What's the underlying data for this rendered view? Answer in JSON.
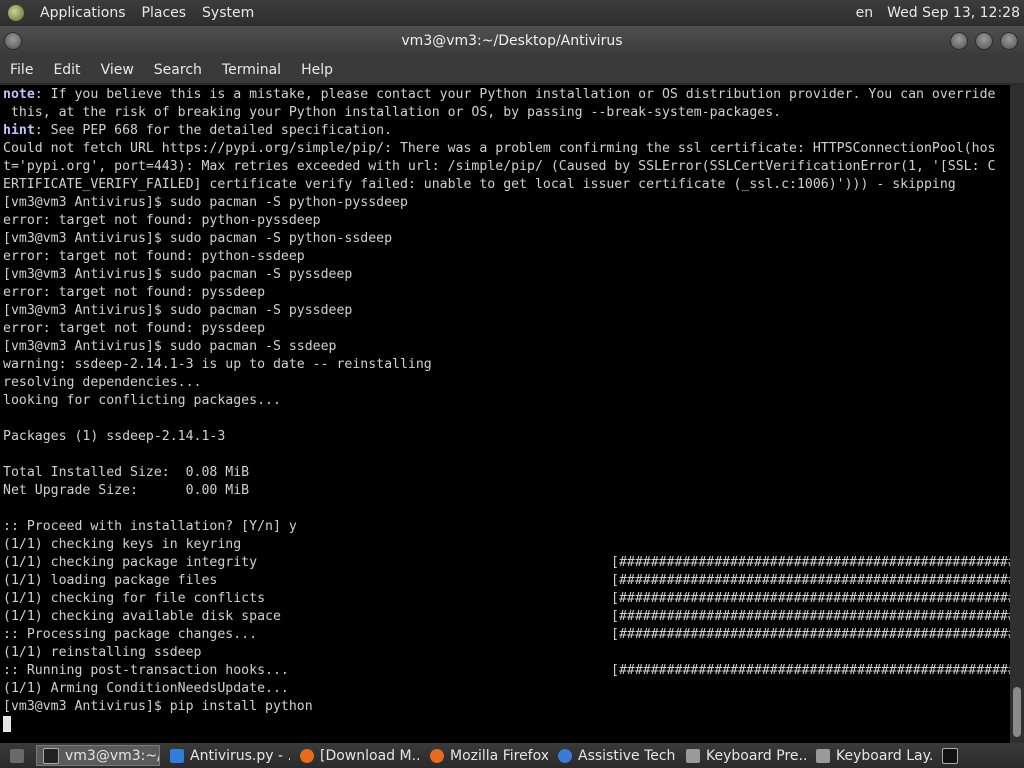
{
  "top_panel": {
    "menus": [
      "Applications",
      "Places",
      "System"
    ],
    "lang": "en",
    "clock": "Wed Sep 13, 12:28"
  },
  "window": {
    "title": "vm3@vm3:~/Desktop/Antivirus"
  },
  "menubar": [
    "File",
    "Edit",
    "View",
    "Search",
    "Terminal",
    "Help"
  ],
  "terminal": {
    "note_label": "note",
    "note_line1": ": If you believe this is a mistake, please contact your Python installation or OS distribution provider. You can override",
    "note_line2": " this, at the risk of breaking your Python installation or OS, by passing --break-system-packages.",
    "hint_label": "hint",
    "hint_text": ": See PEP 668 for the detailed specification.",
    "lines": [
      "Could not fetch URL https://pypi.org/simple/pip/: There was a problem confirming the ssl certificate: HTTPSConnectionPool(hos",
      "t='pypi.org', port=443): Max retries exceeded with url: /simple/pip/ (Caused by SSLError(SSLCertVerificationError(1, '[SSL: C",
      "ERTIFICATE_VERIFY_FAILED] certificate verify failed: unable to get local issuer certificate (_ssl.c:1006)'))) - skipping",
      "[vm3@vm3 Antivirus]$ sudo pacman -S python-pyssdeep",
      "error: target not found: python-pyssdeep",
      "[vm3@vm3 Antivirus]$ sudo pacman -S python-ssdeep",
      "error: target not found: python-ssdeep",
      "[vm3@vm3 Antivirus]$ sudo pacman -S pyssdeep",
      "error: target not found: pyssdeep",
      "[vm3@vm3 Antivirus]$ sudo pacman -S pyssdeep",
      "error: target not found: pyssdeep",
      "[vm3@vm3 Antivirus]$ sudo pacman -S ssdeep",
      "warning: ssdeep-2.14.1-3 is up to date -- reinstalling",
      "resolving dependencies...",
      "looking for conflicting packages...",
      "",
      "Packages (1) ssdeep-2.14.1-3",
      "",
      "Total Installed Size:  0.08 MiB",
      "Net Upgrade Size:      0.00 MiB",
      "",
      ":: Proceed with installation? [Y/n] y",
      "(1/1) checking keys in keyring",
      "(1/1) checking package integrity",
      "(1/1) loading package files",
      "(1/1) checking for file conflicts",
      "(1/1) checking available disk space",
      ":: Processing package changes...",
      "(1/1) reinstalling ssdeep",
      ":: Running post-transaction hooks...",
      "(1/1) Arming ConditionNeedsUpdate...",
      "[vm3@vm3 Antivirus]$ pip install python"
    ],
    "progress_bar": "[######################################################] 100%",
    "progress_rows": [
      true,
      true,
      true,
      true,
      true,
      false,
      true
    ]
  },
  "taskbar": {
    "items": [
      {
        "label": "vm3@vm3:~/...",
        "icon": "terminal-icon"
      },
      {
        "label": "Antivirus.py - ...",
        "icon": "vscode-icon"
      },
      {
        "label": "[Download M...",
        "icon": "firefox-icon"
      },
      {
        "label": "Mozilla Firefox",
        "icon": "firefox-icon"
      },
      {
        "label": "Assistive Tech...",
        "icon": "accessibility-icon"
      },
      {
        "label": "Keyboard Pre...",
        "icon": "keyboard-icon"
      },
      {
        "label": "Keyboard Lay...",
        "icon": "keyboard-icon"
      }
    ]
  }
}
